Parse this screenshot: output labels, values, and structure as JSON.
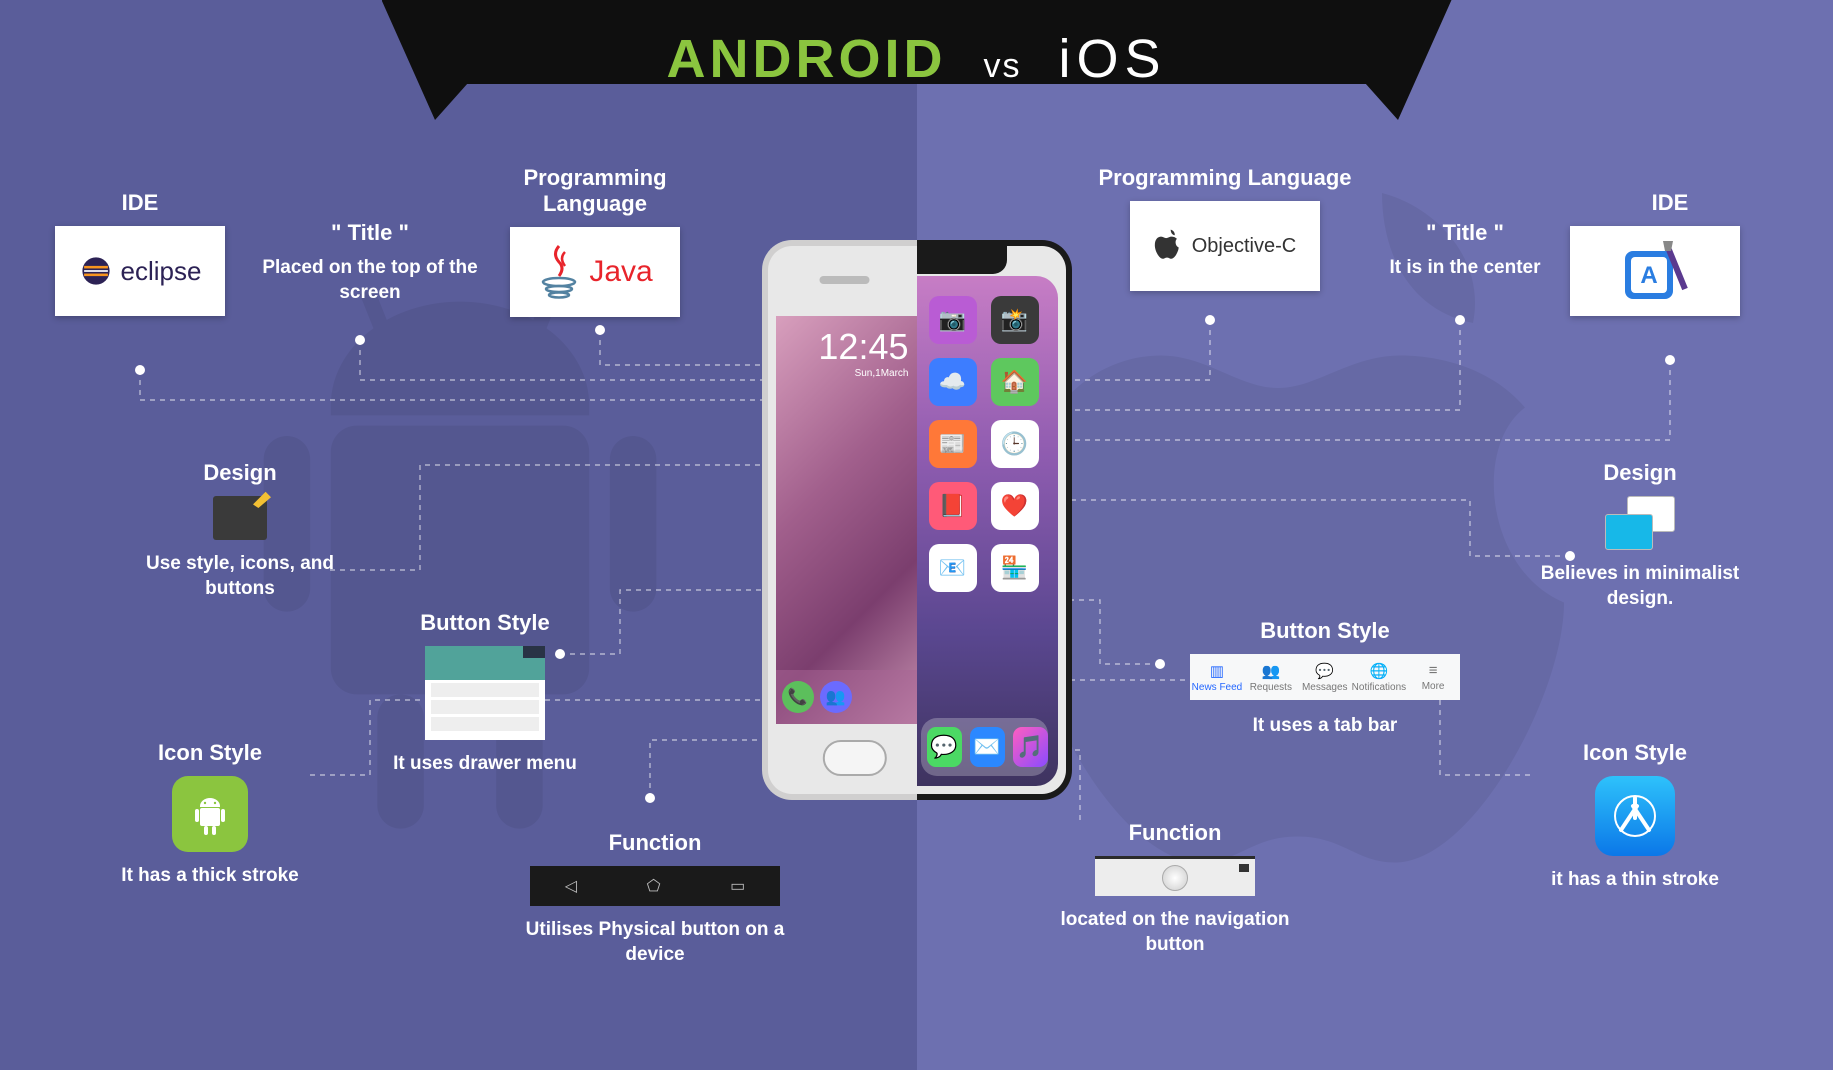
{
  "header": {
    "android": "ANDROID",
    "vs": "vs",
    "ios": "iOS"
  },
  "android": {
    "ide": {
      "label": "IDE",
      "value": "eclipse"
    },
    "title": {
      "label": "\" Title \"",
      "desc": "Placed on the top of the screen"
    },
    "lang": {
      "label": "Programming Language",
      "value": "Java"
    },
    "design": {
      "label": "Design",
      "desc": "Use style, icons, and buttons"
    },
    "button": {
      "label": "Button Style",
      "desc": "It uses drawer menu"
    },
    "icon": {
      "label": "Icon Style",
      "desc": "It has a thick stroke"
    },
    "func": {
      "label": "Function",
      "desc": "Utilises Physical button on a device"
    }
  },
  "ios": {
    "lang": {
      "label": "Programming Language",
      "value": "Objective-C"
    },
    "title": {
      "label": "\" Title \"",
      "desc": "It is in the center"
    },
    "ide": {
      "label": "IDE"
    },
    "design": {
      "label": "Design",
      "desc": "Believes in minimalist design."
    },
    "button": {
      "label": "Button Style",
      "desc": "It uses a tab bar",
      "tabs": [
        "News Feed",
        "Requests",
        "Messages",
        "Notifications",
        "More"
      ]
    },
    "icon": {
      "label": "Icon Style",
      "desc": "it has a thin stroke"
    },
    "func": {
      "label": "Function",
      "desc": "located on the navigation button"
    }
  },
  "phone": {
    "clock": "12:45",
    "date": "Sun,1March"
  }
}
